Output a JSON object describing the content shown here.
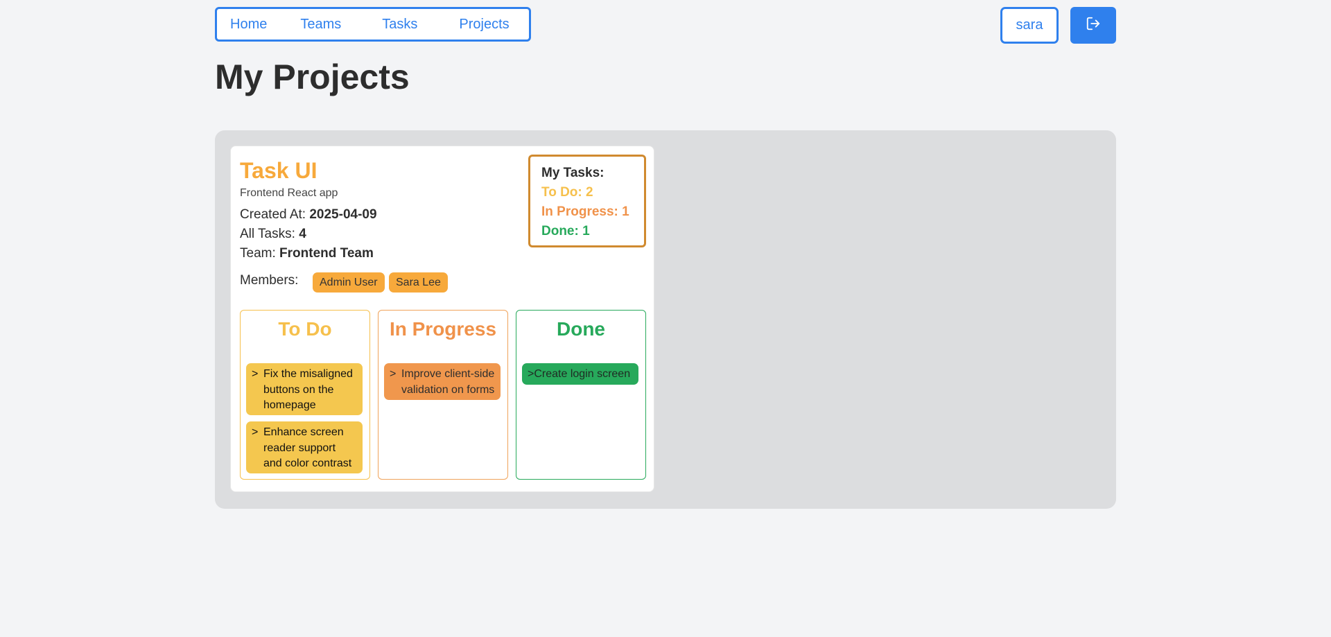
{
  "nav": {
    "items": [
      {
        "label": "Home"
      },
      {
        "label": "Teams"
      },
      {
        "label": "Tasks"
      },
      {
        "label": "Projects"
      }
    ]
  },
  "header": {
    "username": "sara",
    "logout_icon": "logout-icon"
  },
  "page": {
    "title": "My Projects"
  },
  "project": {
    "name": "Task UI",
    "description": "Frontend React app",
    "created_label": "Created At:",
    "created_value": "2025-04-09",
    "tasks_label": "All Tasks:",
    "tasks_value": "4",
    "team_label": "Team:",
    "team_value": "Frontend Team",
    "members_label": "Members:",
    "members": [
      "Admin User",
      "Sara Lee"
    ],
    "my_tasks": {
      "title": "My Tasks:",
      "todo": "To Do: 2",
      "in_progress": "In Progress: 1",
      "done": "Done: 1"
    },
    "columns": [
      {
        "title": "To Do",
        "tasks": [
          {
            "arrow": ">",
            "text": "Fix the misaligned buttons on the homepage"
          },
          {
            "arrow": ">",
            "text": "Enhance screen reader support and color contrast"
          }
        ]
      },
      {
        "title": "In Progress",
        "tasks": [
          {
            "arrow": ">",
            "text": "Improve client-side validation on forms"
          }
        ]
      },
      {
        "title": "Done",
        "tasks": [
          {
            "arrow": ">",
            "text": "Create login screen"
          }
        ]
      }
    ]
  },
  "colors": {
    "primary": "#2f80ed",
    "project_accent": "#f7a93b",
    "todo": "#f6c04c",
    "in_progress": "#f0924a",
    "done": "#27a95b",
    "panel_bg": "#dcdddf"
  }
}
